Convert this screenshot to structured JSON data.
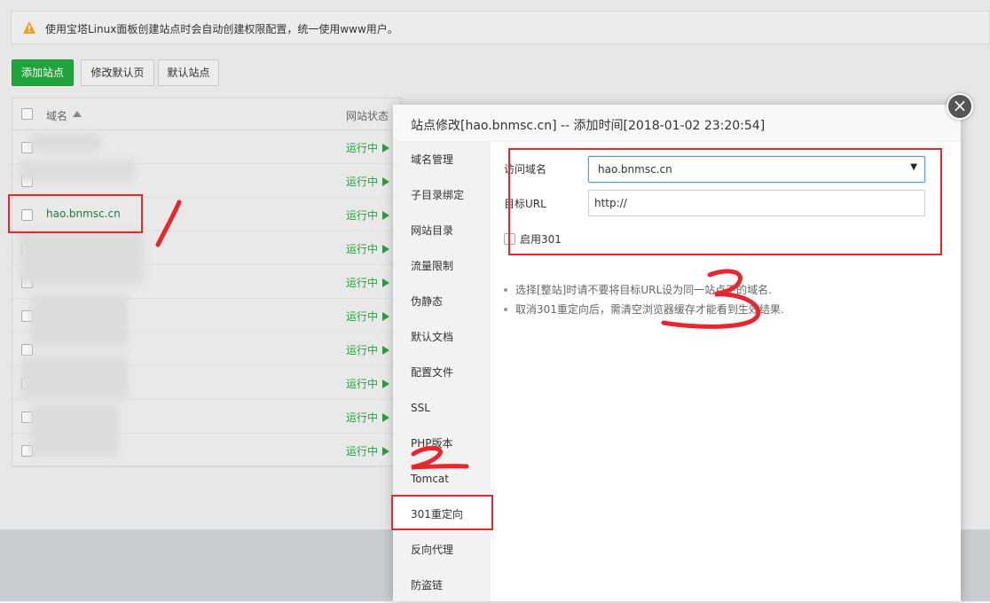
{
  "notice": {
    "icon": "warning-icon",
    "text": "使用宝塔Linux面板创建站点时会自动创建权限配置，统一使用www用户。"
  },
  "toolbar": {
    "add_site": "添加站点",
    "edit_default_page": "修改默认页",
    "default_site": "默认站点"
  },
  "table": {
    "columns": {
      "domain": "域名",
      "status": "网站状态"
    },
    "rows": [
      {
        "domain": "",
        "status": "运行中"
      },
      {
        "domain": "",
        "status": "运行中"
      },
      {
        "domain": "hao.bnmsc.cn",
        "status": "运行中"
      },
      {
        "domain": "",
        "status": "运行中"
      },
      {
        "domain": "",
        "status": "运行中"
      },
      {
        "domain": "",
        "status": "运行中"
      },
      {
        "domain": "",
        "status": "运行中"
      },
      {
        "domain": "",
        "status": "运行中"
      },
      {
        "domain": "",
        "status": "运行中"
      },
      {
        "domain": "",
        "status": "运行中"
      }
    ]
  },
  "modal": {
    "title": "站点修改[hao.bnmsc.cn] -- 添加时间[2018-01-02 23:20:54]",
    "close": "×",
    "sidebar": [
      "域名管理",
      "子目录绑定",
      "网站目录",
      "流量限制",
      "伪静态",
      "默认文档",
      "配置文件",
      "SSL",
      "PHP版本",
      "Tomcat",
      "301重定向",
      "反向代理",
      "防盗链"
    ],
    "active_item": "301重定向",
    "form": {
      "domain_label": "访问域名",
      "domain_value": "hao.bnmsc.cn",
      "target_label": "目标URL",
      "target_value": "http://",
      "enable_label": "启用301"
    },
    "tips": [
      "选择[整站]时请不要将目标URL设为同一站点下的域名.",
      "取消301重定向后，需清空浏览器缓存才能看到生效结果."
    ]
  },
  "annotations": {
    "one": "1",
    "two": "2",
    "three": "3"
  },
  "colors": {
    "primary": "#20a53a",
    "annotation_red": "#e8262b",
    "focus_blue": "#5b9bd5"
  }
}
